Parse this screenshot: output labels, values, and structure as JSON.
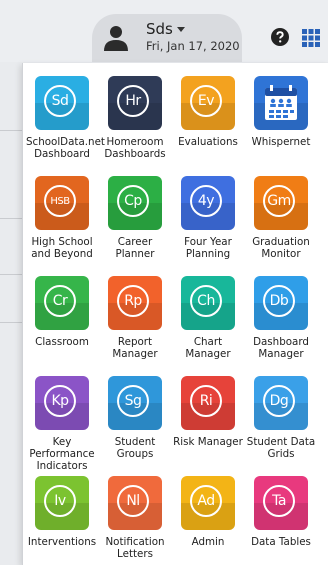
{
  "header": {
    "user_name": "Sds",
    "date": "Fri, Jan 17, 2020"
  },
  "icons": {
    "avatar": "user-icon",
    "help": "help-circle-icon",
    "apps": "apps-grid-icon"
  },
  "colors": {
    "accent": "#2a62b8"
  },
  "apps": [
    {
      "abbr": "Sd",
      "label": "SchoolData.net\nDashboard",
      "color": "#2aaee3"
    },
    {
      "abbr": "Hr",
      "label": "Homeroom\nDashboards",
      "color": "#2f3b57"
    },
    {
      "abbr": "Ev",
      "label": "Evaluations",
      "color": "#f3a21f"
    },
    {
      "abbr": "",
      "label": "Whispernet",
      "color": "#2f74d6"
    },
    {
      "abbr": "HSB",
      "label": "High School\nand Beyond",
      "color": "#e2661f"
    },
    {
      "abbr": "Cp",
      "label": "Career\nPlanner",
      "color": "#2caf45"
    },
    {
      "abbr": "4y",
      "label": "Four Year\nPlanning",
      "color": "#3f6fe0"
    },
    {
      "abbr": "Gm",
      "label": "Graduation\nMonitor",
      "color": "#f07d15"
    },
    {
      "abbr": "Cr",
      "label": "Classroom",
      "color": "#36b54a"
    },
    {
      "abbr": "Rp",
      "label": "Report\nManager",
      "color": "#f2622b"
    },
    {
      "abbr": "Ch",
      "label": "Chart\nManager",
      "color": "#18b79a"
    },
    {
      "abbr": "Db",
      "label": "Dashboard\nManager",
      "color": "#2f9ee8"
    },
    {
      "abbr": "Kp",
      "label": "Key\nPerformance\nIndicators",
      "color": "#8b54c7"
    },
    {
      "abbr": "Sg",
      "label": "Student\nGroups",
      "color": "#2f97da"
    },
    {
      "abbr": "Ri",
      "label": "Risk Manager",
      "color": "#e6433a"
    },
    {
      "abbr": "Dg",
      "label": "Student Data\nGrids",
      "color": "#3aa0e8"
    },
    {
      "abbr": "Iv",
      "label": "Interventions",
      "color": "#7cc330"
    },
    {
      "abbr": "Nl",
      "label": "Notification\nLetters",
      "color": "#f06a3c"
    },
    {
      "abbr": "Ad",
      "label": "Admin",
      "color": "#f3b416"
    },
    {
      "abbr": "Ta",
      "label": "Data Tables",
      "color": "#e8397e"
    }
  ]
}
